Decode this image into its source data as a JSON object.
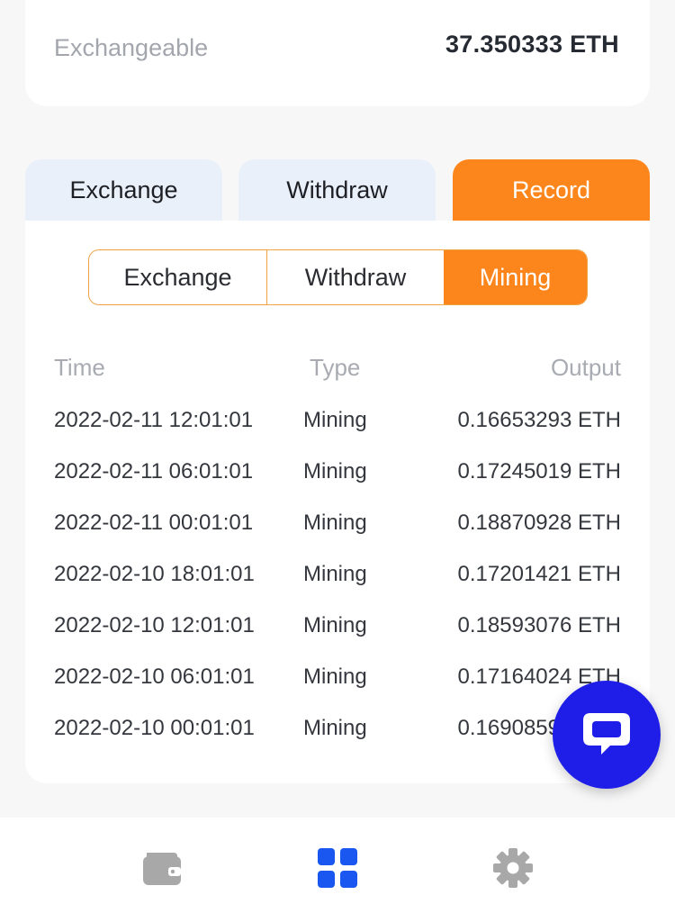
{
  "balance": {
    "label": "Exchangeable",
    "value": "37.350333 ETH"
  },
  "main_tabs": [
    {
      "label": "Exchange",
      "active": false
    },
    {
      "label": "Withdraw",
      "active": false
    },
    {
      "label": "Record",
      "active": true
    }
  ],
  "record_tabs": [
    {
      "label": "Exchange",
      "active": false
    },
    {
      "label": "Withdraw",
      "active": false
    },
    {
      "label": "Mining",
      "active": true
    }
  ],
  "table": {
    "headers": {
      "time": "Time",
      "type": "Type",
      "output": "Output"
    },
    "rows": [
      {
        "time": "2022-02-11 12:01:01",
        "type": "Mining",
        "output": "0.16653293 ETH"
      },
      {
        "time": "2022-02-11 06:01:01",
        "type": "Mining",
        "output": "0.17245019 ETH"
      },
      {
        "time": "2022-02-11 00:01:01",
        "type": "Mining",
        "output": "0.18870928 ETH"
      },
      {
        "time": "2022-02-10 18:01:01",
        "type": "Mining",
        "output": "0.17201421 ETH"
      },
      {
        "time": "2022-02-10 12:01:01",
        "type": "Mining",
        "output": "0.18593076 ETH"
      },
      {
        "time": "2022-02-10 06:01:01",
        "type": "Mining",
        "output": "0.17164024 ETH"
      },
      {
        "time": "2022-02-10 00:01:01",
        "type": "Mining",
        "output": "0.16908597 ETH"
      }
    ]
  },
  "colors": {
    "accent": "#fd861c",
    "tab_inactive_bg": "#eaf0fa",
    "chat_button": "#1f1ee8",
    "nav_active": "#1a56f0",
    "nav_inactive": "#a8a8a8"
  },
  "icons": {
    "chat": "chat-bubble-icon",
    "nav": [
      "wallet-icon",
      "apps-grid-icon",
      "gear-icon"
    ]
  }
}
